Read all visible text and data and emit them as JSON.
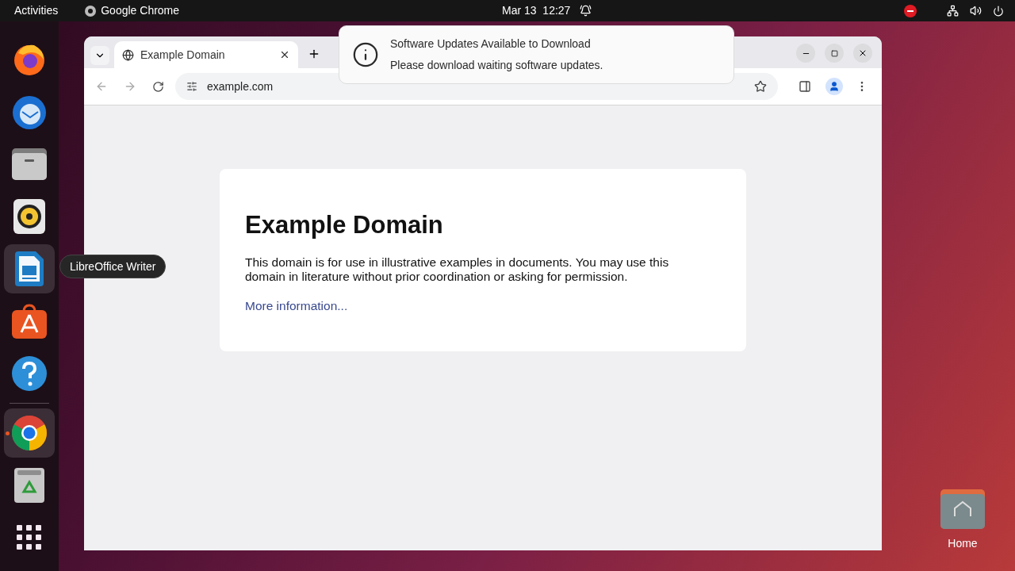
{
  "top_bar": {
    "activities": "Activities",
    "app": "Google Chrome",
    "clock": "Mar 13  12:27"
  },
  "dock": {
    "apps": [
      {
        "kind": "firefox",
        "highlighted": false,
        "running": false
      },
      {
        "kind": "thunderbird",
        "highlighted": false,
        "running": false
      },
      {
        "kind": "files",
        "highlighted": false,
        "running": false
      },
      {
        "kind": "rhythmbox",
        "highlighted": false,
        "running": false
      },
      {
        "kind": "writer",
        "highlighted": true,
        "running": false
      },
      {
        "kind": "software",
        "highlighted": false,
        "running": false
      },
      {
        "kind": "help",
        "highlighted": false,
        "running": false
      },
      {
        "kind": "chrome",
        "highlighted": true,
        "running": true
      },
      {
        "kind": "trash",
        "highlighted": false,
        "running": false
      },
      {
        "kind": "apps",
        "highlighted": false,
        "running": false
      }
    ],
    "tooltip": "LibreOffice Writer"
  },
  "browser": {
    "tab": {
      "title": "Example Domain",
      "selected": true
    },
    "url": "example.com",
    "page": {
      "heading": "Example Domain",
      "paragraph": "This domain is for use in illustrative examples in documents. You may use this domain in literature without prior coordination or asking for permission.",
      "link": "More information..."
    }
  },
  "notification": {
    "title": "Software Updates Available to Download",
    "body": "Please download waiting software updates."
  },
  "desktop": {
    "icon_label": "Home"
  }
}
